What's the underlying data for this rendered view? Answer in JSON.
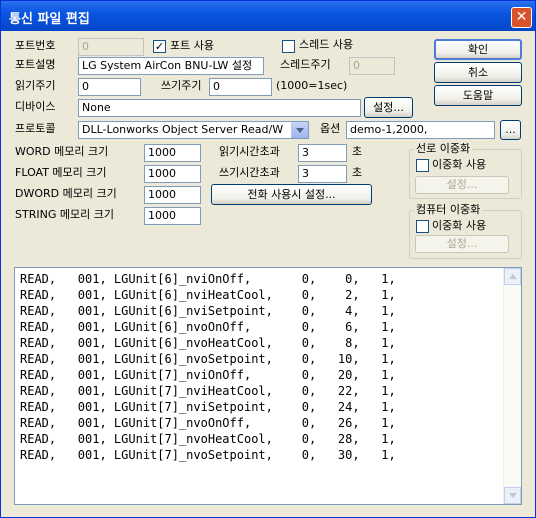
{
  "window": {
    "title": "통신 파일 편집",
    "close_label": "✕"
  },
  "port_no": {
    "label": "포트번호",
    "value": "0"
  },
  "port_use": {
    "label": "포트 사용",
    "checked": true
  },
  "thread_use": {
    "label": "스레드 사용",
    "checked": false
  },
  "port_desc": {
    "label": "포트설명",
    "value": "LG System AirCon BNU-LW 설정"
  },
  "thread_cycle": {
    "label": "스레드주기",
    "value": "0"
  },
  "read_cycle": {
    "label": "읽기주기",
    "value": "0"
  },
  "write_cycle": {
    "label": "쓰기주기",
    "value": "0"
  },
  "cycle_unit": "(1000=1sec)",
  "device": {
    "label": "디바이스",
    "value": "None",
    "button": "설정..."
  },
  "protocol": {
    "label": "프로토콜",
    "value": "DLL-Lonworks Object Server Read/W"
  },
  "option": {
    "label": "옵션",
    "value": "demo-1,2000,",
    "button": "..."
  },
  "memory": {
    "word": {
      "label": "WORD 메모리 크기",
      "value": "1000"
    },
    "float": {
      "label": "FLOAT 메모리 크기",
      "value": "1000"
    },
    "dword": {
      "label": "DWORD 메모리 크기",
      "value": "1000"
    },
    "string": {
      "label": "STRING 메모리 크기",
      "value": "1000"
    }
  },
  "read_timeout": {
    "label": "읽기시간초과",
    "value": "3",
    "unit": "초"
  },
  "write_timeout": {
    "label": "쓰기시간초과",
    "value": "3",
    "unit": "초"
  },
  "phone_setting_button": "전화 사용시 설정...",
  "buttons": {
    "ok": "확인",
    "cancel": "취소",
    "help": "도움말"
  },
  "line_redundancy": {
    "title": "선로 이중화",
    "checkbox": "이중화 사용",
    "button": "설정..."
  },
  "computer_redundancy": {
    "title": "컴퓨터 이중화",
    "checkbox": "이중화 사용",
    "button": "설정..."
  },
  "rows": [
    "READ,   001, LGUnit[6]_nviOnOff,       0,    0,   1,",
    "READ,   001, LGUnit[6]_nviHeatCool,    0,    2,   1,",
    "READ,   001, LGUnit[6]_nviSetpoint,    0,    4,   1,",
    "READ,   001, LGUnit[6]_nvoOnOff,       0,    6,   1,",
    "READ,   001, LGUnit[6]_nvoHeatCool,    0,    8,   1,",
    "READ,   001, LGUnit[6]_nvoSetpoint,    0,   10,   1,",
    "READ,   001, LGUnit[7]_nviOnOff,       0,   20,   1,",
    "READ,   001, LGUnit[7]_nviHeatCool,    0,   22,   1,",
    "READ,   001, LGUnit[7]_nviSetpoint,    0,   24,   1,",
    "READ,   001, LGUnit[7]_nvoOnOff,       0,   26,   1,",
    "READ,   001, LGUnit[7]_nvoHeatCool,    0,   28,   1,",
    "READ,   001, LGUnit[7]_nvoSetpoint,    0,   30,   1,"
  ]
}
